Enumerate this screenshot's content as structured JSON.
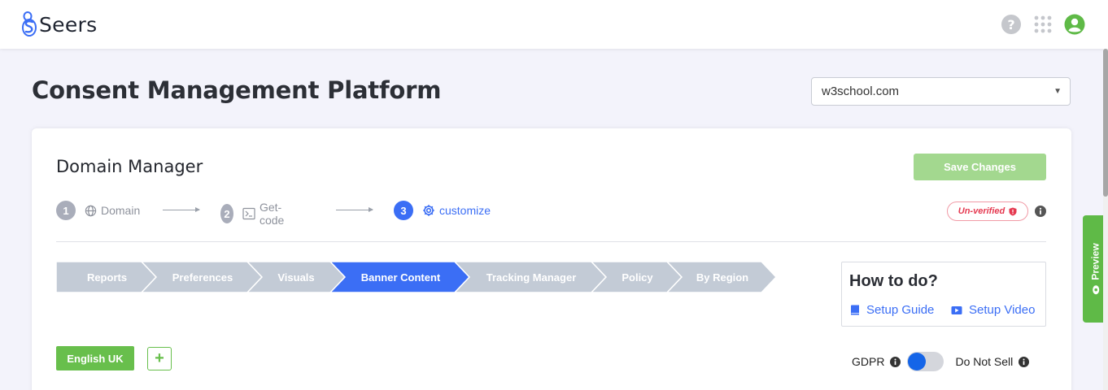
{
  "header": {
    "brand": "Seers",
    "icons": [
      "help-icon",
      "apps-grid-icon",
      "user-account-icon"
    ]
  },
  "page": {
    "title": "Consent Management Platform",
    "domain_select": {
      "value": "w3school.com"
    }
  },
  "card": {
    "title": "Domain Manager",
    "save_label": "Save Changes",
    "status_badge": "Un-verified",
    "steps": [
      {
        "num": "1",
        "label": "Domain",
        "icon": "globe-icon",
        "active": false
      },
      {
        "num": "2",
        "label": "Get-code",
        "icon": "terminal-icon",
        "active": false
      },
      {
        "num": "3",
        "label": "customize",
        "icon": "gear-icon",
        "active": true
      }
    ],
    "tabs": [
      {
        "label": "Reports",
        "active": false
      },
      {
        "label": "Preferences",
        "active": false
      },
      {
        "label": "Visuals",
        "active": false
      },
      {
        "label": "Banner Content",
        "active": true
      },
      {
        "label": "Tracking Manager",
        "active": false
      },
      {
        "label": "Policy",
        "active": false
      },
      {
        "label": "By Region",
        "active": false
      }
    ],
    "howto": {
      "title": "How to do?",
      "guide_label": "Setup Guide",
      "video_label": "Setup Video"
    },
    "language_label": "English UK",
    "add_label": "+",
    "gdpr_label": "GDPR",
    "gdpr_toggle_on": false,
    "do_not_sell_label": "Do Not Sell"
  },
  "preview_label": "Preview",
  "colors": {
    "primary_blue": "#3b6ef5",
    "green": "#68bf4c",
    "save_disabled": "#a3d88f",
    "tab_inactive": "#c3cbd6",
    "danger": "#e53950"
  }
}
